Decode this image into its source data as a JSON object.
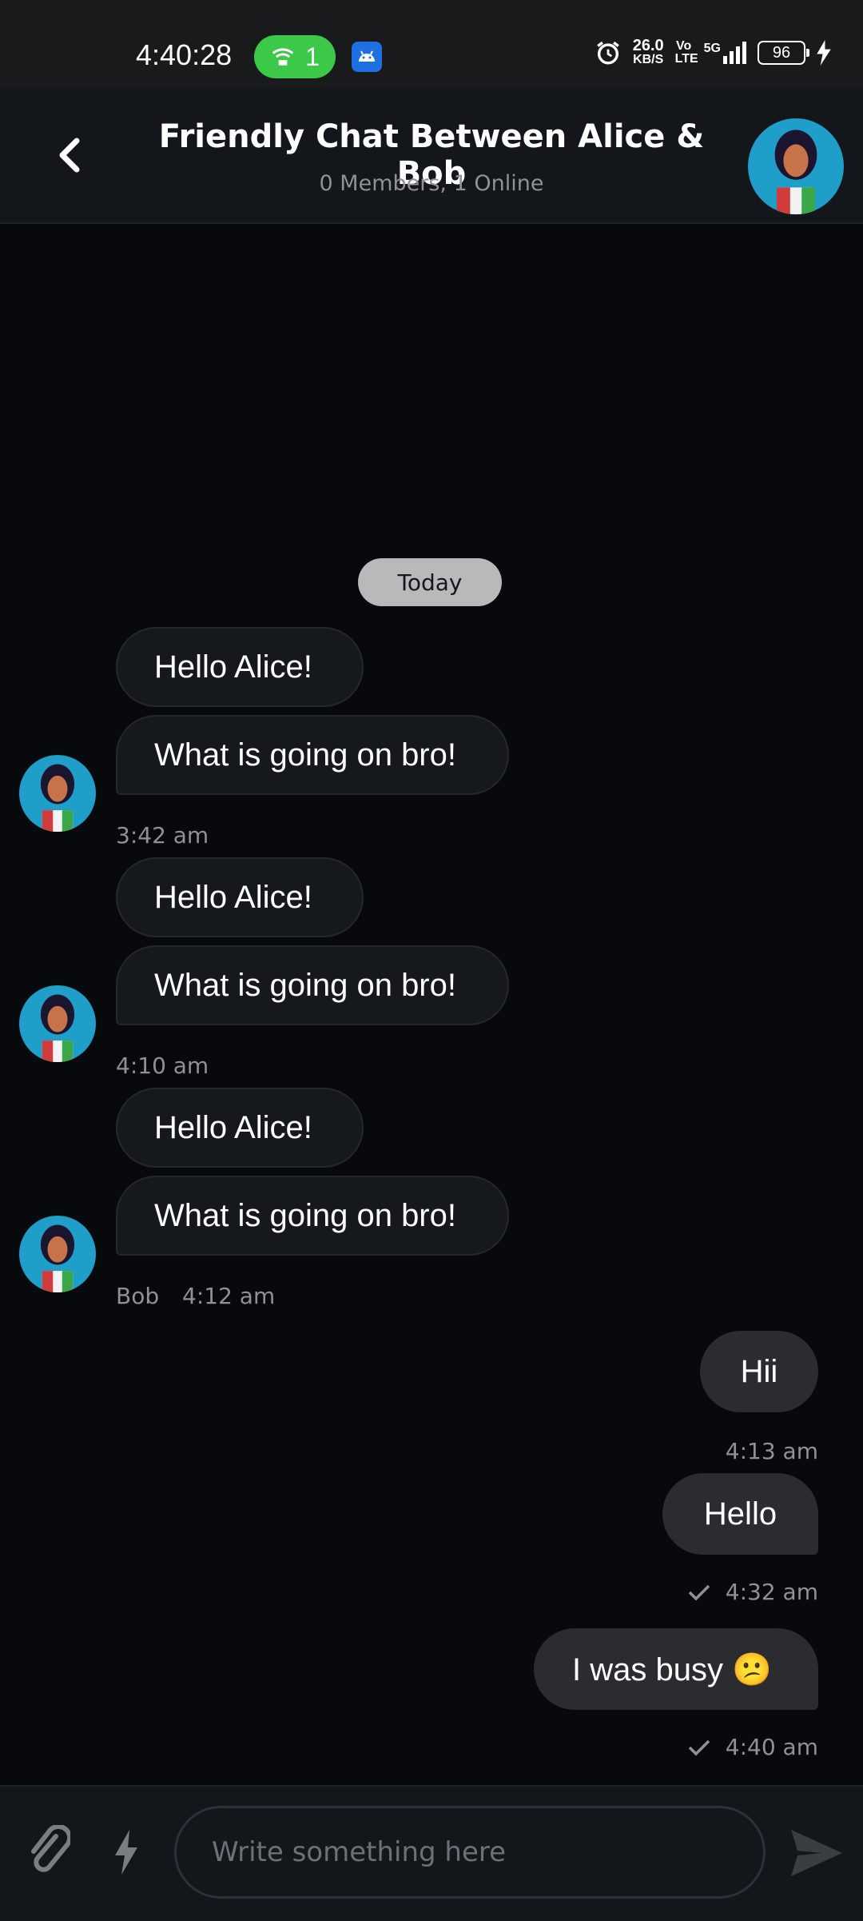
{
  "status_bar": {
    "time": "4:40:28",
    "hotspot_count": "1",
    "speed_value": "26.0",
    "speed_unit": "KB/S",
    "volte": "Vo LTE",
    "network": "5G",
    "battery": "96"
  },
  "header": {
    "title": "Friendly Chat Between Alice & Bob",
    "subtitle": "0 Members, 1 Online"
  },
  "day_separator": "Today",
  "messages": {
    "g1": {
      "m1": "Hello Alice!",
      "m2": "What is going on bro!",
      "time": "3:42 am"
    },
    "g2": {
      "m1": "Hello Alice!",
      "m2": "What is going on bro!",
      "time": "4:10 am"
    },
    "g3": {
      "m1": "Hello Alice!",
      "m2": "What is going on bro!",
      "sender": "Bob",
      "time": "4:12 am"
    },
    "out1": {
      "text": "Hii",
      "time": "4:13 am"
    },
    "out2": {
      "text": "Hello",
      "time": "4:32 am"
    },
    "out3": {
      "text": "I was busy 😕",
      "time": "4:40 am"
    }
  },
  "composer": {
    "placeholder": "Write something here"
  },
  "colors": {
    "background": "#07090c",
    "header": "#13161b",
    "incoming_bubble": "#15181d",
    "outgoing_bubble": "#2a2c30",
    "hotspot": "#3cc94a",
    "avatar_bg": "#1e9ec8"
  },
  "icons": [
    "back-arrow-icon",
    "paperclip-icon",
    "lightning-icon",
    "send-icon",
    "alarm-icon",
    "android-icon",
    "hotspot-icon",
    "signal-icon",
    "battery-icon",
    "check-icon"
  ]
}
